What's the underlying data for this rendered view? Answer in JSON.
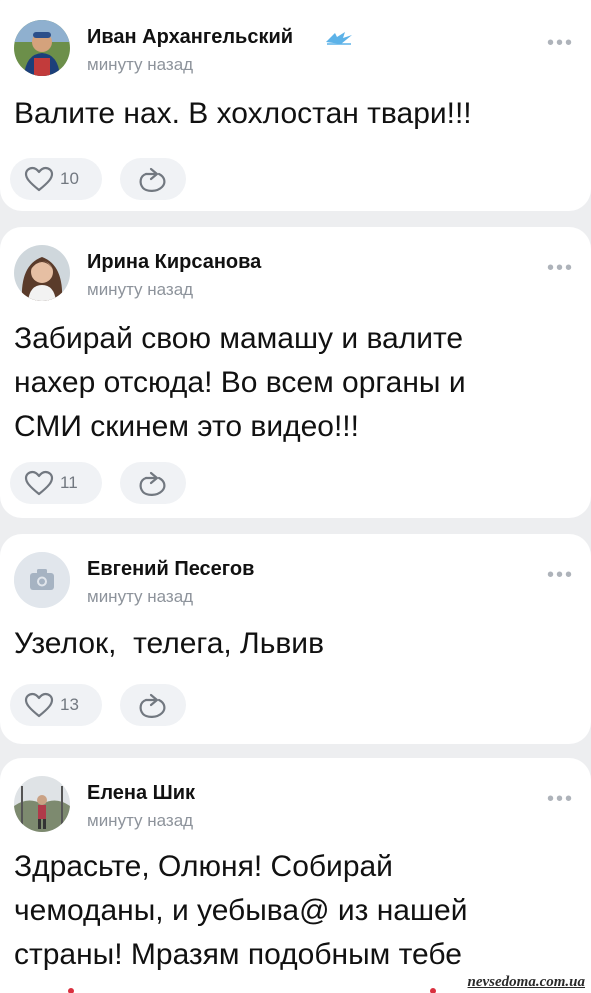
{
  "posts": [
    {
      "author": "Иван Архангельский",
      "time": "минуту назад",
      "text": "Валите нах. В хохлостан твари!!!",
      "likes": "10",
      "avatar": "user-photo",
      "badge": "zenit-club-logo"
    },
    {
      "author": "Ирина Кирсанова",
      "time": "минуту назад",
      "text": "Забирай свою мамашу и валите нахер отсюда! Во всем органы и СМИ скинем это видео!!!",
      "likes": "11",
      "avatar": "user-photo"
    },
    {
      "author": "Евгений Песегов",
      "time": "минуту назад",
      "text": "Узелок,  телега, Львив",
      "likes": "13",
      "avatar": "camera-placeholder"
    },
    {
      "author": "Елена Шик",
      "time": "минуту назад",
      "text": "Здрасьте, Олюня! Собирай чемоданы, и уебыва@ из нашей страны! Мразям подобным тебе",
      "avatar": "user-photo"
    }
  ],
  "menu_glyph": "•••",
  "watermark": "nevsedoma.com.ua",
  "colors": {
    "background": "#edeef0",
    "card": "#ffffff",
    "meta": "#8d939b",
    "pill": "#f0f2f5",
    "icon": "#727880"
  }
}
